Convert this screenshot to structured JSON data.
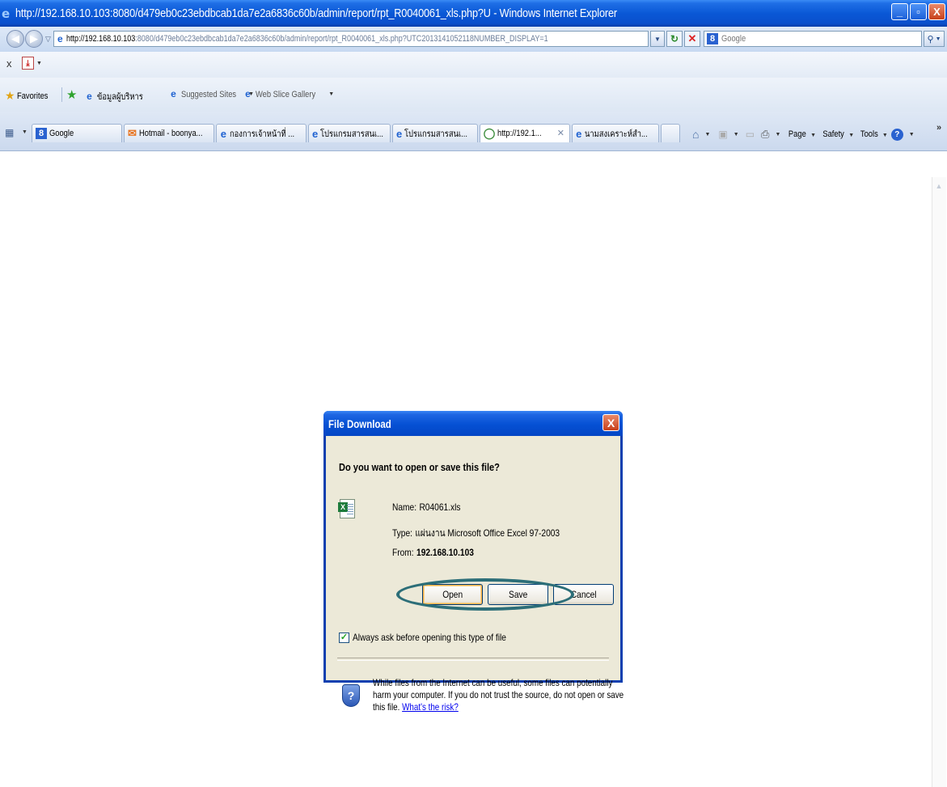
{
  "window": {
    "title": "http://192.168.10.103:8080/d479eb0c23ebdbcab1da7e2a6836c60b/admin/report/rpt_R0040061_xls.php?U - Windows Internet Explorer",
    "minimize_label": "_",
    "maximize_label": "▫",
    "close_label": "X"
  },
  "address_bar": {
    "url_host": "http://192.168.10.103",
    "url_rest": ":8080/d479eb0c23ebdbcab1da7e2a6836c60b/admin/report/rpt_R0040061_xls.php?UTC2013141052118NUMBER_DISPLAY=1",
    "search_placeholder": "Google",
    "search_engine_icon": "8"
  },
  "command_row": {
    "close_label": "x"
  },
  "favorites_bar": {
    "favorites_label": "Favorites",
    "items": [
      {
        "label": "ข้อมูลผู้บริหาร",
        "icon": "ie-icon"
      },
      {
        "label": "Suggested Sites",
        "icon": "ie-icon"
      },
      {
        "label": "Web Slice Gallery",
        "icon": "ie-icon"
      }
    ]
  },
  "tabs": [
    {
      "label": "Google",
      "icon": "google-icon"
    },
    {
      "label": "Hotmail - boonya...",
      "icon": "hotmail-icon"
    },
    {
      "label": "กองการเจ้าหน้าที่ ...",
      "icon": "ie-icon"
    },
    {
      "label": "โปรแกรมสารสนเ...",
      "icon": "ie-icon"
    },
    {
      "label": "โปรแกรมสารสนเ...",
      "icon": "ie-icon"
    },
    {
      "label": "http://192.1...",
      "icon": "loading-icon",
      "active": true
    },
    {
      "label": "นามสงเคราะห์สำ...",
      "icon": "ie-icon"
    }
  ],
  "command_bar": {
    "page_label": "Page",
    "safety_label": "Safety",
    "tools_label": "Tools",
    "help_label": "?",
    "more_label": "»"
  },
  "dialog": {
    "title": "File Download",
    "close_label": "X",
    "question": "Do you want to open or save this file?",
    "name_label": "Name:",
    "name_value": "R04061.xls",
    "type_label": "Type:",
    "type_value": "แผ่นงาน Microsoft Office Excel 97-2003",
    "from_label": "From:",
    "from_value": "192.168.10.103",
    "open_label": "Open",
    "save_label": "Save",
    "cancel_label": "Cancel",
    "always_ask_label": "Always ask before opening this type of file",
    "always_ask_checked": true,
    "warning_text": "While files from the Internet can be useful, some files can potentially harm your computer. If you do not trust the source, do not open or save this file.",
    "risk_link": "What's the risk?"
  }
}
